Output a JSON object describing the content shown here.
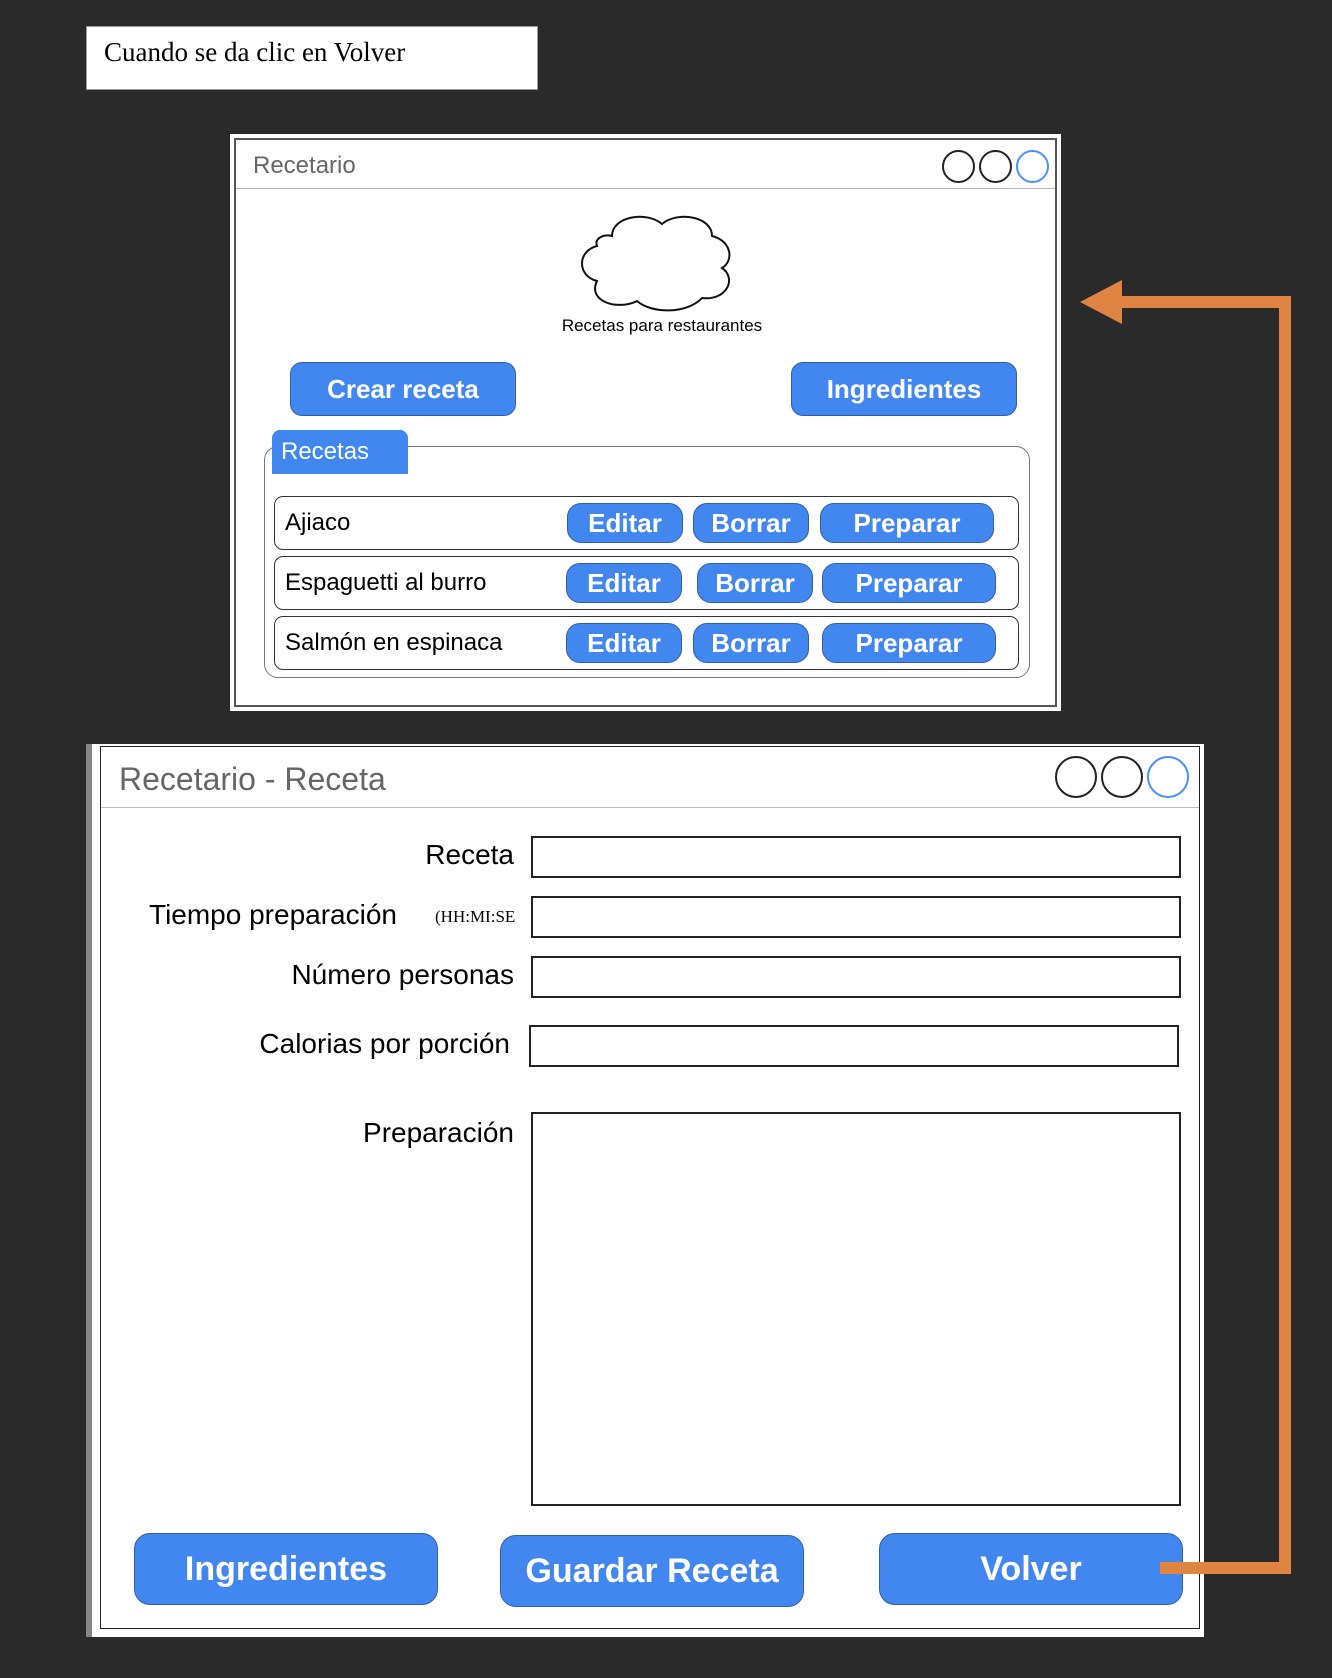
{
  "note": {
    "text": "Cuando se da clic en Volver"
  },
  "window_main": {
    "title": "Recetario",
    "logo_icon": "cloud-icon",
    "slogan": "Recetas para restaurantes",
    "create_button": "Crear receta",
    "ingredients_button": "Ingredientes",
    "group_label": "Recetas",
    "rows": [
      {
        "name": "Ajiaco",
        "edit": "Editar",
        "delete": "Borrar",
        "prepare": "Preparar"
      },
      {
        "name": "Espaguetti al burro",
        "edit": "Editar",
        "delete": "Borrar",
        "prepare": "Preparar"
      },
      {
        "name": "Salmón en espinaca",
        "edit": "Editar",
        "delete": "Borrar",
        "prepare": "Preparar"
      }
    ]
  },
  "window_recipe": {
    "title": "Recetario - Receta",
    "fields": {
      "recipe_label": "Receta",
      "time_label": "Tiempo preparación",
      "time_hint": "(HH:MI:SE",
      "people_label": "Número personas",
      "calories_label": "Calorias por porción",
      "preparation_label": "Preparación"
    },
    "buttons": {
      "ingredients": "Ingredientes",
      "save": "Guardar Receta",
      "back": "Volver"
    }
  },
  "colors": {
    "button_blue": "#4287ef",
    "arrow_orange": "#e08444",
    "background": "#2a2a2a"
  }
}
